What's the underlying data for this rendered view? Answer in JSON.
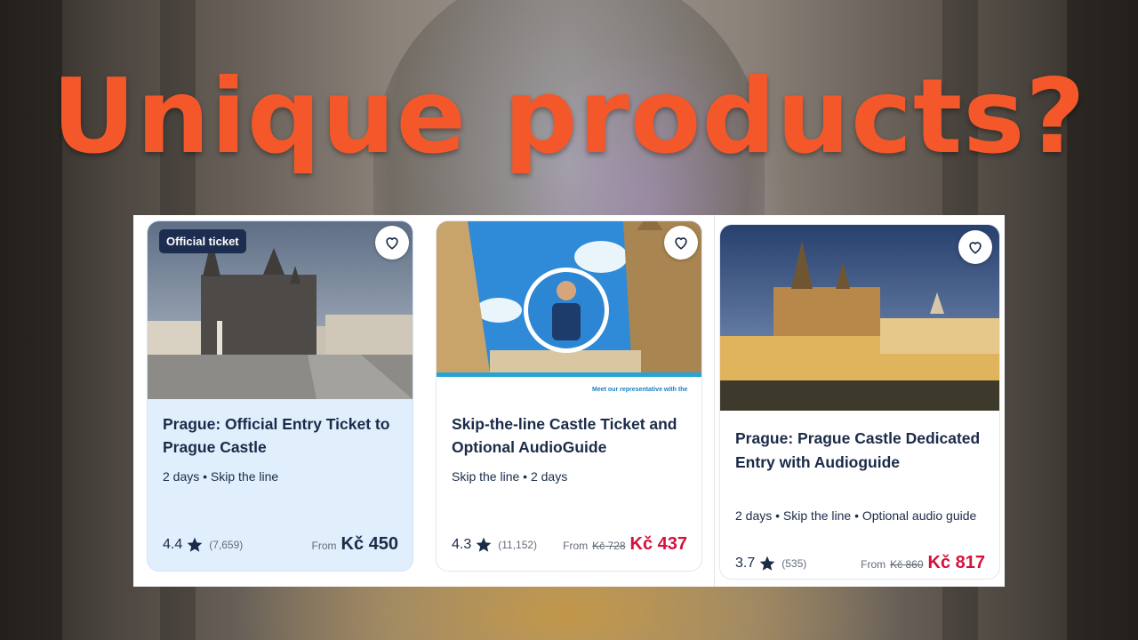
{
  "headline": "Unique products?",
  "cards": [
    {
      "badge": "Official ticket",
      "title": "Prague: Official Entry Ticket to Prague Castle",
      "meta": "2 days • Skip the line",
      "rating": "4.4",
      "reviews": "(7,659)",
      "from": "From",
      "price": "Kč 450"
    },
    {
      "image_caption": "Meet our representative with the",
      "title": "Skip-the-line Castle Ticket and Optional AudioGuide",
      "meta": "Skip the line • 2 days",
      "rating": "4.3",
      "reviews": "(11,152)",
      "from": "From",
      "old_price": "Kč 728",
      "price": "Kč 437"
    },
    {
      "title": "Prague: Prague Castle Dedicated Entry with Audioguide",
      "meta": "2 days • Skip the line • Optional audio guide",
      "rating": "3.7",
      "reviews": "(535)",
      "from": "From",
      "old_price": "Kč 860",
      "price": "Kč 817"
    }
  ],
  "colors": {
    "headline": "#f4582a",
    "navy": "#1a2b49",
    "sale_price": "#d5103b",
    "highlight_card": "#e1eefc"
  },
  "icons": [
    "heart-icon",
    "star-icon"
  ]
}
